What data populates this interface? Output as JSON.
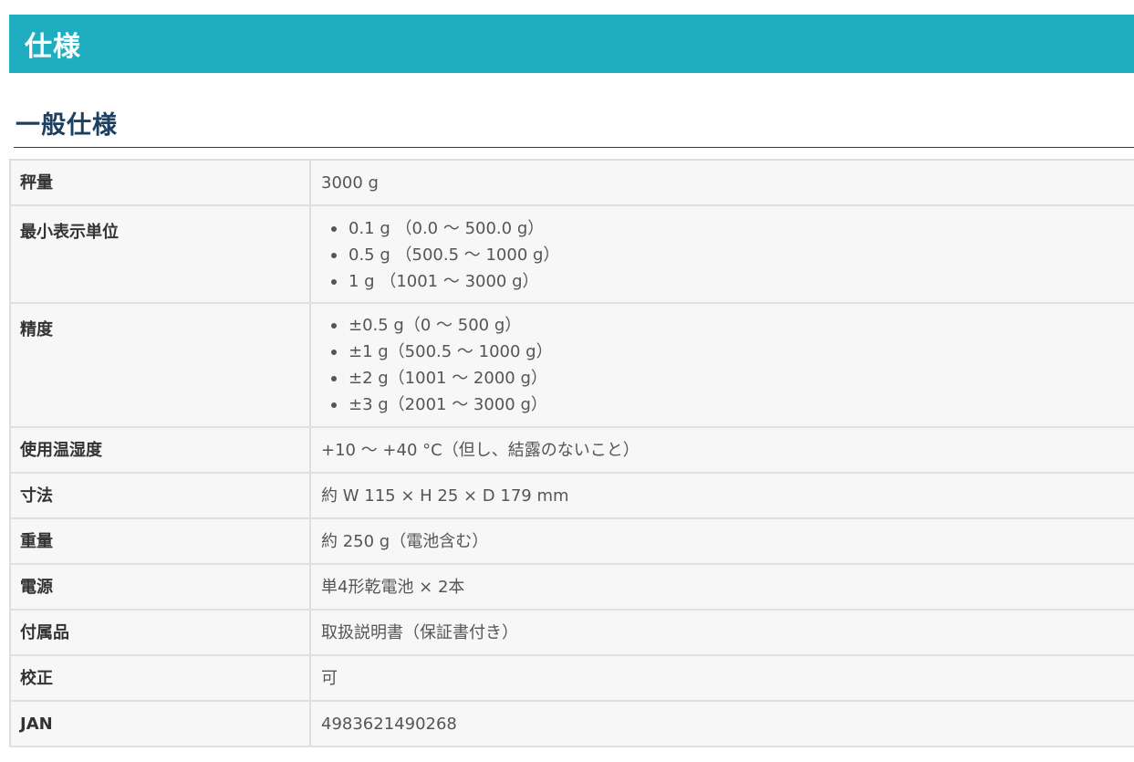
{
  "page": {
    "title": "仕様"
  },
  "section": {
    "heading": "一般仕様"
  },
  "specs": {
    "capacity": {
      "label": "秤量",
      "value": "3000 g"
    },
    "min_display": {
      "label": "最小表示単位",
      "items": [
        "0.1 g （0.0 ～ 500.0 g）",
        "0.5 g （500.5 ～ 1000 g）",
        "1 g （1001 ～ 3000 g）"
      ]
    },
    "accuracy": {
      "label": "精度",
      "items": [
        "±0.5 g（0 ～ 500 g）",
        "±1 g（500.5 ～ 1000 g）",
        "±2 g（1001 ～ 2000 g）",
        "±3 g（2001 ～ 3000 g）"
      ]
    },
    "operating_temp": {
      "label": "使用温湿度",
      "value": "+10 ～ +40 °C（但し、結露のないこと）"
    },
    "dimensions": {
      "label": "寸法",
      "value": "約 W 115 × H 25 × D 179 mm"
    },
    "weight": {
      "label": "重量",
      "value": "約 250 g（電池含む）"
    },
    "power": {
      "label": "電源",
      "value": "単4形乾電池 × 2本"
    },
    "accessories": {
      "label": "付属品",
      "value": "取扱説明書（保証書付き）"
    },
    "calibration": {
      "label": "校正",
      "value": "可"
    },
    "jan": {
      "label": "JAN",
      "value": "4983621490268"
    }
  },
  "colors": {
    "banner": "#1eaebf",
    "heading": "#1d4060",
    "table_bg": "#f7f7f7",
    "border": "#dedede"
  }
}
